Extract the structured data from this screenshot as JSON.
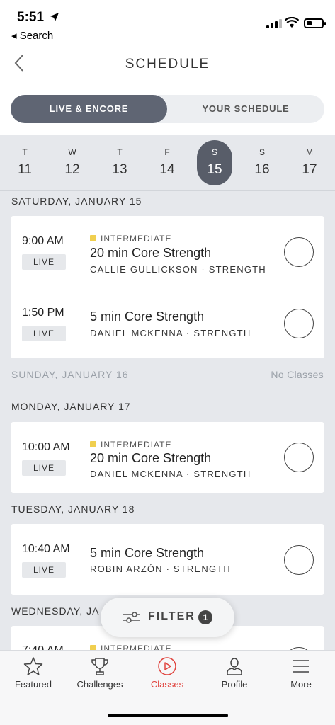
{
  "status_bar": {
    "time": "5:51",
    "back_app": "◂ Search"
  },
  "header": {
    "title": "SCHEDULE"
  },
  "segments": {
    "active": "LIVE & ENCORE",
    "inactive": "YOUR SCHEDULE"
  },
  "days": [
    {
      "letter": "T",
      "num": "11"
    },
    {
      "letter": "W",
      "num": "12"
    },
    {
      "letter": "T",
      "num": "13"
    },
    {
      "letter": "F",
      "num": "14"
    },
    {
      "letter": "S",
      "num": "15"
    },
    {
      "letter": "S",
      "num": "16"
    },
    {
      "letter": "M",
      "num": "17"
    }
  ],
  "sections": [
    {
      "heading": "SATURDAY, JANUARY 15",
      "classes": [
        {
          "time": "9:00 AM",
          "badge": "LIVE",
          "level": "INTERMEDIATE",
          "name": "20 min Core Strength",
          "meta": "CALLIE GULLICKSON · STRENGTH"
        },
        {
          "time": "1:50 PM",
          "badge": "LIVE",
          "level": "",
          "name": "5 min Core Strength",
          "meta": "DANIEL MCKENNA · STRENGTH"
        }
      ]
    },
    {
      "heading": "SUNDAY, JANUARY 16",
      "note": "No Classes"
    },
    {
      "heading": "MONDAY, JANUARY 17",
      "classes": [
        {
          "time": "10:00 AM",
          "badge": "LIVE",
          "level": "INTERMEDIATE",
          "name": "20 min Core Strength",
          "meta": "DANIEL MCKENNA · STRENGTH"
        }
      ]
    },
    {
      "heading": "TUESDAY, JANUARY 18",
      "classes": [
        {
          "time": "10:40 AM",
          "badge": "LIVE",
          "level": "",
          "name": "5 min Core Strength",
          "meta": "ROBIN ARZÓN · STRENGTH"
        }
      ]
    },
    {
      "heading": "WEDNESDAY, JA",
      "classes": [
        {
          "time": "7:40 AM",
          "badge": "",
          "level": "INTERMEDIATE",
          "name": "",
          "meta": ""
        }
      ]
    }
  ],
  "filter": {
    "label": "FILTER",
    "count": "1"
  },
  "tabs": [
    {
      "label": "Featured",
      "icon": "star-icon"
    },
    {
      "label": "Challenges",
      "icon": "trophy-icon"
    },
    {
      "label": "Classes",
      "icon": "play-circle-icon"
    },
    {
      "label": "Profile",
      "icon": "person-icon"
    },
    {
      "label": "More",
      "icon": "menu-icon"
    }
  ],
  "colors": {
    "accent": "#e0443e",
    "segment_active": "#5f6573",
    "level_yellow": "#f0cf4f"
  }
}
